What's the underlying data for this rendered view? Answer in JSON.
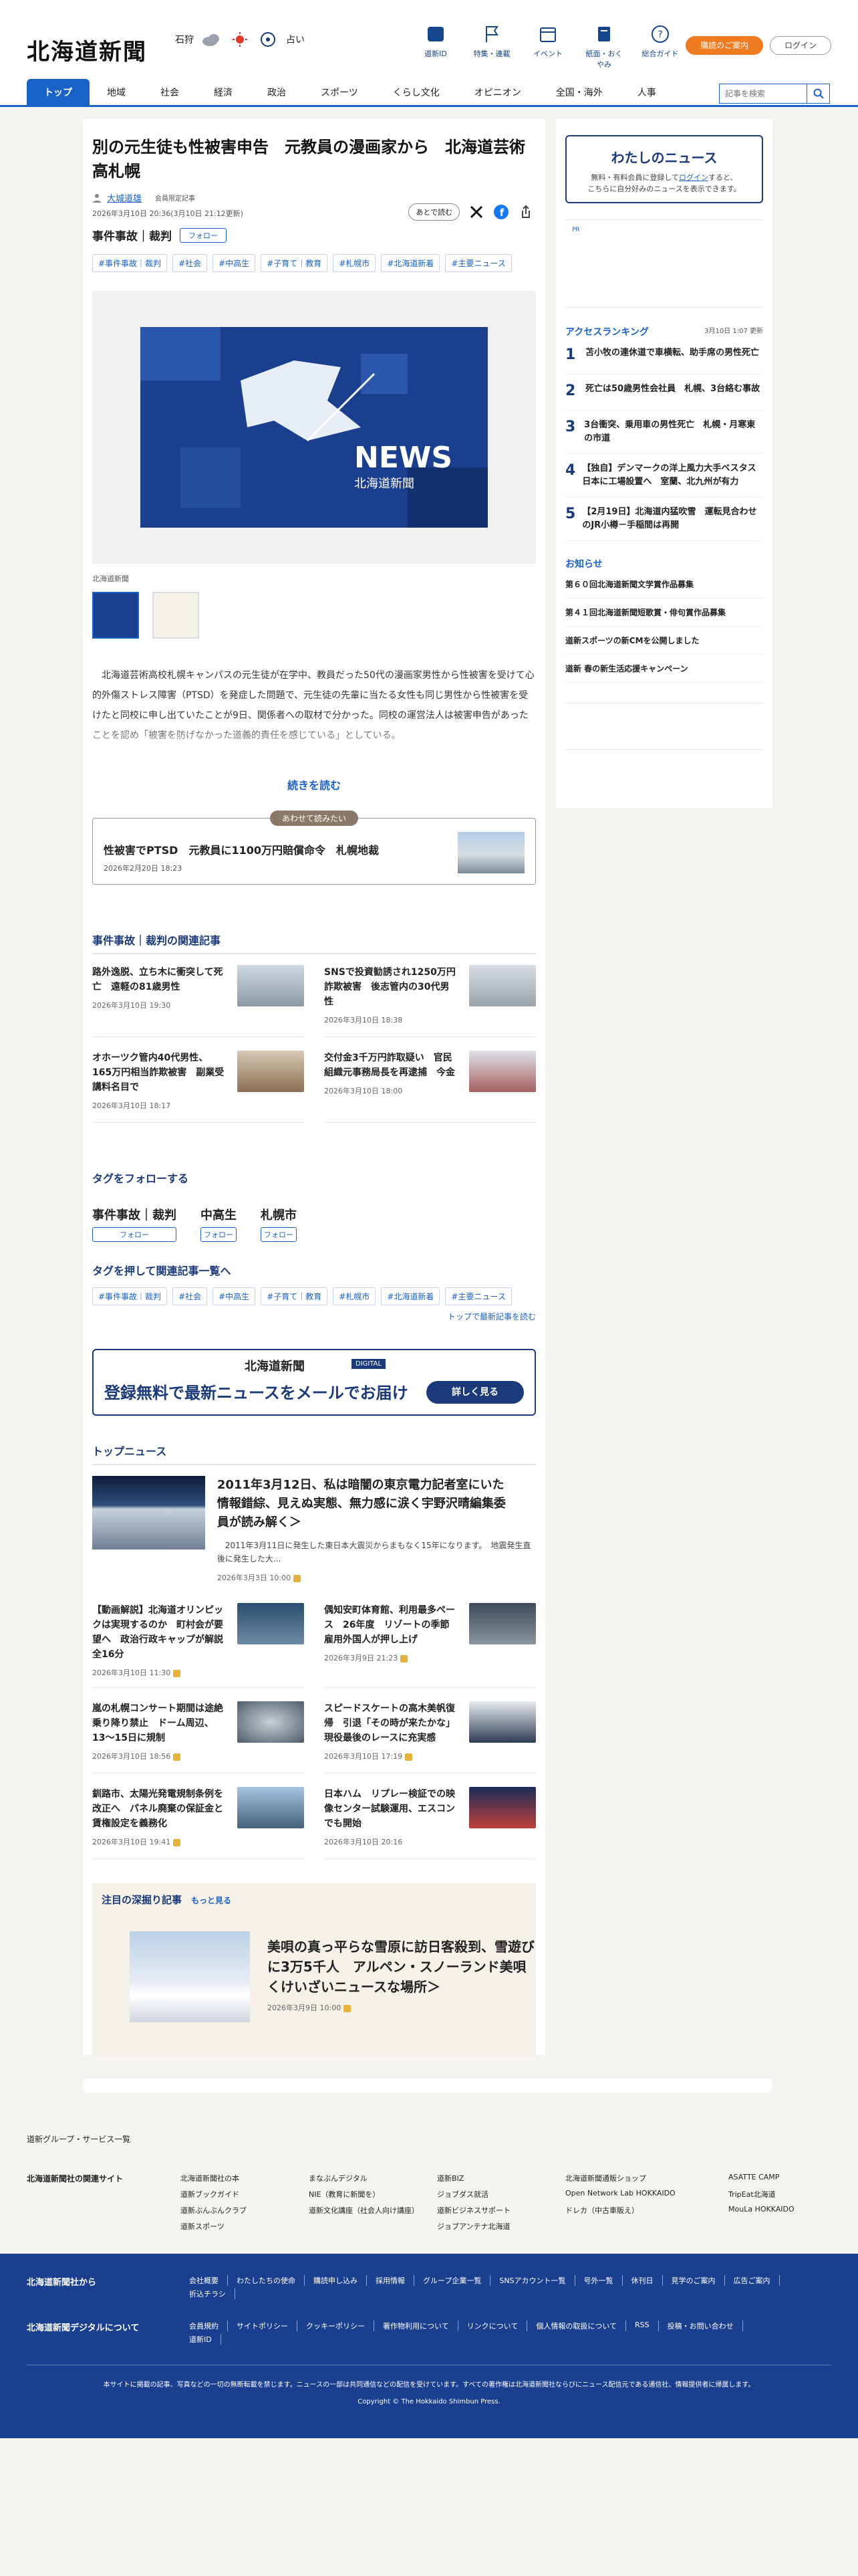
{
  "header": {
    "logo": "北海道新聞",
    "weather_city": "石狩",
    "fortune": "占い",
    "nav": [
      {
        "label": "道新ID",
        "icon": "id-icon"
      },
      {
        "label": "特集・連載",
        "icon": "flag-icon"
      },
      {
        "label": "イベント",
        "icon": "calendar-icon"
      },
      {
        "label": "紙面・おくやみ",
        "icon": "newspaper-icon"
      },
      {
        "label": "総合ガイド",
        "icon": "help-icon"
      }
    ],
    "subscribe": "購読のご案内",
    "login": "ログイン",
    "gnav": [
      "トップ",
      "地域",
      "社会",
      "経済",
      "政治",
      "スポーツ",
      "くらし文化",
      "オピニオン",
      "全国・海外",
      "人事"
    ],
    "search_placeholder": "記事を検索"
  },
  "article": {
    "title": "別の元生徒も性被害申告　元教員の漫画家から　北海道芸術高札幌",
    "author": "大城道雄",
    "member_note": "会員限定記事",
    "date": "2026年3月10日 20:36(3月10日 21:12更新)",
    "read_later": "あとで読む",
    "category": "事件事故｜裁判",
    "follow": "フォロー",
    "tags": [
      "#事件事故｜裁判",
      "#社会",
      "#中高生",
      "#子育て｜教育",
      "#札幌市",
      "#北海道新着",
      "#主要ニュース"
    ],
    "photo_caption": "北海道新聞",
    "photo_text": "NEWS",
    "photo_logo": "北海道新聞",
    "lead": "　北海道芸術高校札幌キャンパスの元生徒が在学中、教員だった50代の漫画家男性から性被害を受けて心的外傷ストレス障害（PTSD）を発症した問題で、元生徒の先輩に当たる女性も同じ男性から性被害を受けたと同校に申し出ていたことが9日、関係者への取材で分かった。同校の運営法人は被害申告があったことを認め「被害を防げなかった道義的責任を感じている」としている。",
    "more": "続きを読む",
    "also": {
      "label": "あわせて読みたい",
      "title": "性被害でPTSD　元教員に1100万円賠償命令　札幌地裁",
      "date": "2026年2月20日 18:23"
    }
  },
  "related": {
    "heading": "事件事故｜裁判の関連記事",
    "items": [
      {
        "title": "路外逸脱、立ち木に衝突して死亡　遠軽の81歳男性",
        "date": "2026年3月10日 19:30"
      },
      {
        "title": "SNSで投資勧誘され1250万円詐欺被害　後志管内の30代男性",
        "date": "2026年3月10日 18:38"
      },
      {
        "title": "オホーツク管内40代男性、165万円相当詐欺被害　副業受講料名目で",
        "date": "2026年3月10日 18:17"
      },
      {
        "title": "交付金3千万円詐取疑い　官民組織元事務局長を再逮捕　今金",
        "date": "2026年3月10日 18:00"
      }
    ]
  },
  "follow_tags": {
    "heading": "タグをフォローする",
    "items": [
      "事件事故｜裁判",
      "中高生",
      "札幌市"
    ],
    "button": "フォロー"
  },
  "tag_list": {
    "heading": "タグを押して関連記事一覧へ",
    "more": "トップで最新記事を読む"
  },
  "banner": {
    "logo": "北海道新聞",
    "digital": "DIGITAL",
    "message": "登録無料で最新ニュースをメールでお届け",
    "button": "詳しく見る"
  },
  "top_news": {
    "heading": "トップニュース",
    "lead": {
      "title": "2011年3月12日、私は暗闇の東京電力記者室にいた　情報錯綜、見えぬ実態、無力感に涙く宇野沢晴編集委員が読み解く＞",
      "summary": "　2011年3月11日に発生した東日本大震災からまもなく15年になります。　地震発生直後に発生した大...",
      "date": "2026年3月3日 10:00"
    },
    "items": [
      {
        "title": "【動画解説】北海道オリンピックは実現するのか　町村会が要望へ　政治行政キャップが解説　全16分",
        "date": "2026年3月10日 11:30"
      },
      {
        "title": "偶知安町体育館、利用最多ペース　26年度　リゾートの季節雇用外国人が押し上げ",
        "date": "2026年3月9日 21:23"
      },
      {
        "title": "嵐の札幌コンサート期間は途絶乗り降り禁止　ドーム周辺、13～15日に規制",
        "date": "2026年3月10日 18:56"
      },
      {
        "title": "スピードスケートの高木美帆復帰　引退「その時が来たかな」現役最後のレースに充実感",
        "date": "2026年3月10日 17:19"
      },
      {
        "title": "釧路市、太陽光発電規制条例を改正へ　パネル廃棄の保証金と賃権設定を義務化",
        "date": "2026年3月10日 19:41"
      },
      {
        "title": "日本ハム　リプレー検証での映像センター試験運用、エスコンでも開始",
        "date": "2026年3月10日 20:16"
      }
    ]
  },
  "deep": {
    "label": "注目の深掘り記事",
    "more": "もっと見る",
    "title": "美唄の真っ平らな雪原に訪日客殺到、雪遊びに3万5千人　アルペン・スノーランド美唄くけいざいニュースな場所＞",
    "date": "2026年3月9日 10:00"
  },
  "sidebar": {
    "my_news": "わたしのニュース",
    "my_desc1": "無料・有料会員に登録して",
    "my_login": "ログイン",
    "my_desc2": "すると、",
    "my_desc3": "こちらに自分好みのニュースを表示できます。",
    "pr": "PR",
    "rank_heading": "アクセスランキング",
    "rank_date": "3月10日 1:07 更新",
    "ranking": [
      "苫小牧の連休道で車横転、助手席の男性死亡",
      "死亡は50歳男性会社員　札幌、3台絡む事故",
      "3台衝突、乗用車の男性死亡　札幌・月寒東の市道",
      "【独自】デンマークの洋上風力大手ベスタス　日本に工場設置へ　室蘭、北九州が有力",
      "【2月19日】北海道内猛吹雪　運転見合わせのJR小樽－手稲間は再開"
    ],
    "news_heading": "お知らせ",
    "news": [
      "第６０回北海道新聞文学賞作品募集",
      "第４１回北海道新聞短歌賞・俳句賞作品募集",
      "道新スポーツの新CMを公開しました",
      "道新 春の新生活応援キャンペーン"
    ]
  },
  "footer": {
    "group": "道新グループ・サービス一覧",
    "related_label": "北海道新聞社の関連サイト",
    "sites": [
      "北海道新聞社の本",
      "まなぶんデジタル",
      "道新BIZ",
      "北海道新聞通販ショップ",
      "ASATTE CAMP",
      "道新ブックガイド",
      "NIE（教育に新聞を）",
      "ジョブダス就活",
      "Open Network Lab HOKKAIDO",
      "TripEat北海道",
      "道新ぶんぶんクラブ",
      "道新文化講座（社会人向け講座）",
      "道新ビジネスサポート",
      "ドレカ（中古車販え）",
      "MouLa HOKKAIDO",
      "道新スポーツ",
      "",
      "ジョブアンテナ北海道",
      "",
      ""
    ],
    "company_label": "北海道新聞社から",
    "company_links": [
      "会社概要",
      "わたしたちの使命",
      "購読申し込み",
      "採用情報",
      "グループ企業一覧",
      "SNSアカウント一覧",
      "号外一覧",
      "休刊日",
      "見学のご案内",
      "広告ご案内",
      "折込チラシ"
    ],
    "digital_label": "北海道新聞デジタルについて",
    "digital_links": [
      "会員規約",
      "サイトポリシー",
      "クッキーポリシー",
      "著作物利用について",
      "リンクについて",
      "個人情報の取扱について",
      "RSS",
      "投稿・お問い合わせ",
      "道新ID"
    ],
    "notice": "本サイトに掲載の記事、写真などの一切の無断転載を禁じます。ニュースの一部は共同通信などの配信を受けています。すべての著作権は北海道新聞社ならびにニュース配信元である通信社、情報提供者に帰属します。",
    "copyright": "Copyright © The Hokkaido Shimbun Press."
  },
  "colors": {
    "accent": "#1a62c8",
    "navy": "#1a3a7a",
    "orange": "#f07a1e",
    "footer": "#1b3f8f"
  }
}
